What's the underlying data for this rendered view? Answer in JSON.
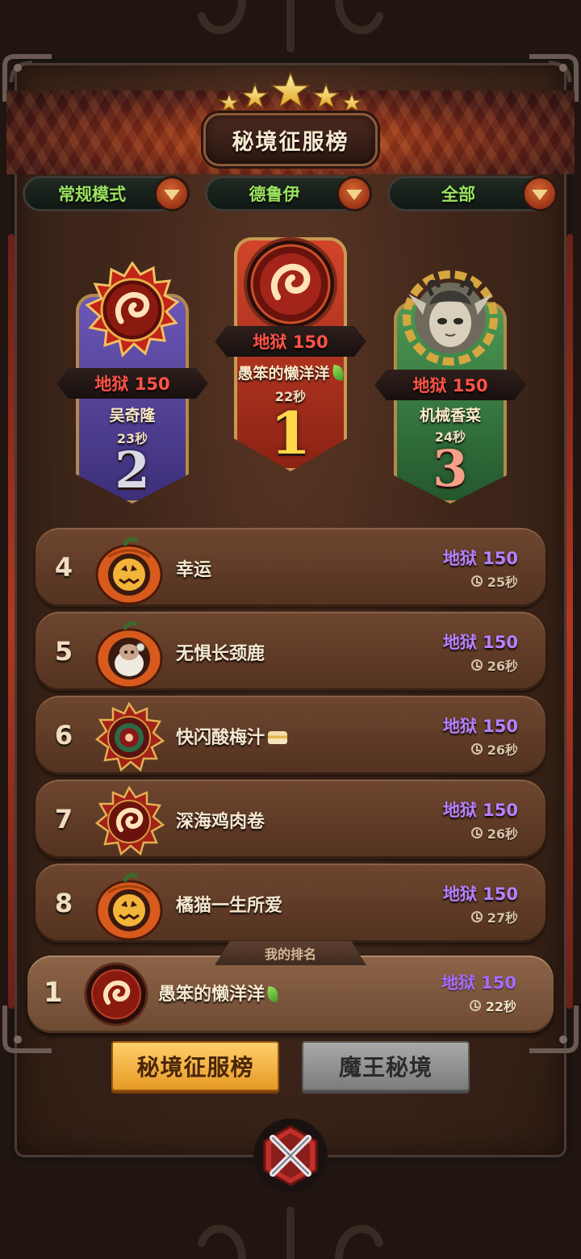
{
  "title": "秘境征服榜",
  "filters": [
    {
      "label": "常规模式"
    },
    {
      "label": "德鲁伊"
    },
    {
      "label": "全部"
    }
  ],
  "podium": {
    "first": {
      "rank": "1",
      "difficulty": "地狱 150",
      "name": "愚笨的懒洋洋",
      "time": "22秒",
      "avatar": "fire-swirl-icon"
    },
    "second": {
      "rank": "2",
      "difficulty": "地狱 150",
      "name": "吴奇隆",
      "time": "23秒",
      "avatar": "fire-swirl-icon"
    },
    "third": {
      "rank": "3",
      "difficulty": "地狱 150",
      "name": "机械香菜",
      "time": "24秒",
      "avatar": "horned-elf-portrait"
    }
  },
  "rows": [
    {
      "rank": "4",
      "name": "幸运",
      "difficulty": "地狱 150",
      "time": "25秒",
      "avatar": "pumpkin-jack-icon"
    },
    {
      "rank": "5",
      "name": "无惧长颈鹿",
      "difficulty": "地狱 150",
      "time": "26秒",
      "avatar": "pumpkin-sheep-icon"
    },
    {
      "rank": "6",
      "name": "快闪酸梅汁",
      "difficulty": "地狱 150",
      "time": "26秒",
      "avatar": "target-eye-icon"
    },
    {
      "rank": "7",
      "name": "深海鸡肉卷",
      "difficulty": "地狱 150",
      "time": "26秒",
      "avatar": "fire-swirl-icon"
    },
    {
      "rank": "8",
      "name": "橘猫一生所爱",
      "difficulty": "地狱 150",
      "time": "27秒",
      "avatar": "pumpkin-jack-icon"
    }
  ],
  "my_rank": {
    "tag": "我的排名",
    "rank": "1",
    "name": "愚笨的懒洋洋",
    "difficulty": "地狱 150",
    "time": "22秒",
    "avatar": "fire-swirl-icon"
  },
  "tabs": [
    {
      "label": "秘境征服榜",
      "active": true
    },
    {
      "label": "魔王秘境",
      "active": false
    }
  ],
  "colors": {
    "filter_text": "#9be35e",
    "podium_difficulty": "#ff5347",
    "list_difficulty": "#b581ff",
    "gold_rank": "#ffd84a",
    "silver_rank": "#d9dae6",
    "bronze_rank": "#f4a088"
  }
}
